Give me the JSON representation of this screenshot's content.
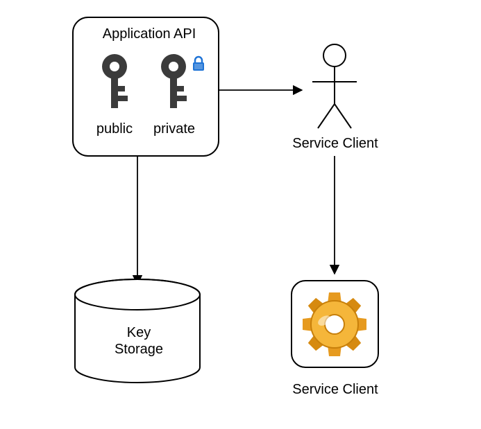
{
  "diagram": {
    "title": "Application API",
    "key_public_label": "public",
    "key_private_label": "private",
    "storage_label": "Key\nStorage",
    "actor_label": "Service Client",
    "service_label": "Service Client"
  }
}
